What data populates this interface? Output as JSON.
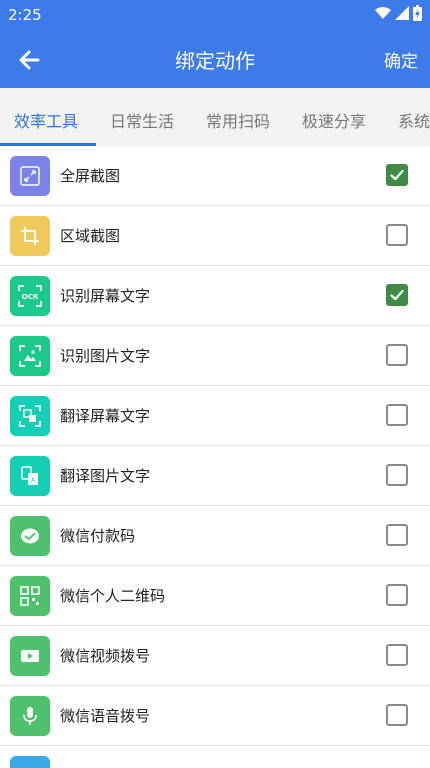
{
  "status": {
    "time": "2:25"
  },
  "header": {
    "title": "绑定动作",
    "confirm_label": "确定"
  },
  "tabs": [
    {
      "label": "效率工具",
      "active": true
    },
    {
      "label": "日常生活",
      "active": false
    },
    {
      "label": "常用扫码",
      "active": false
    },
    {
      "label": "极速分享",
      "active": false
    },
    {
      "label": "系统",
      "active": false
    }
  ],
  "colors": {
    "primary": "#3d7ce8",
    "check_green": "#3f8b46"
  },
  "items": [
    {
      "label": "全屏截图",
      "checked": true,
      "icon": "fullscreen-icon",
      "color": "#7b82e8"
    },
    {
      "label": "区域截图",
      "checked": false,
      "icon": "crop-icon",
      "color": "#f1c85a"
    },
    {
      "label": "识别屏幕文字",
      "checked": true,
      "icon": "ocr-icon",
      "color": "#1bc98a"
    },
    {
      "label": "识别图片文字",
      "checked": false,
      "icon": "image-text-icon",
      "color": "#1bc98a"
    },
    {
      "label": "翻译屏幕文字",
      "checked": false,
      "icon": "translate-screen-icon",
      "color": "#13cfb6"
    },
    {
      "label": "翻译图片文字",
      "checked": false,
      "icon": "translate-image-icon",
      "color": "#13cfb6"
    },
    {
      "label": "微信付款码",
      "checked": false,
      "icon": "wechat-pay-icon",
      "color": "#4fc16d"
    },
    {
      "label": "微信个人二维码",
      "checked": false,
      "icon": "qrcode-icon",
      "color": "#4fc16d"
    },
    {
      "label": "微信视频拨号",
      "checked": false,
      "icon": "video-call-icon",
      "color": "#4fc16d"
    },
    {
      "label": "微信语音拨号",
      "checked": false,
      "icon": "microphone-icon",
      "color": "#4fc16d"
    }
  ]
}
